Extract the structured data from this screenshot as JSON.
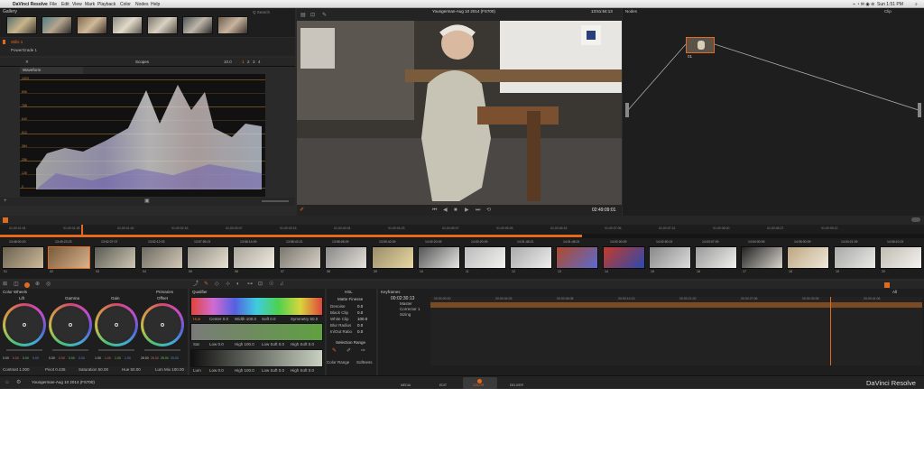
{
  "menubar": {
    "apple": "",
    "app": "DaVinci Resolve",
    "items": [
      "File",
      "Edit",
      "View",
      "Mark",
      "Playback",
      "Color",
      "Nodes",
      "Help"
    ],
    "clock": "Sun 1:51 PM"
  },
  "gallery": {
    "title": "Gallery",
    "search": "Q Search",
    "stills": "Stills 1",
    "powergrade": "PowerGrade 1"
  },
  "scopes": {
    "title": "Scopes",
    "mode": "Waveform",
    "zoom": "10.0",
    "channels": [
      "1",
      "2",
      "3",
      "4"
    ],
    "ticks": [
      "1023",
      "896",
      "768",
      "640",
      "512",
      "384",
      "256",
      "128",
      "0"
    ]
  },
  "viewer": {
    "title": "Youngerman-Aug 10 2014 (FS700)",
    "timecode": "13:51:64:13",
    "current": "02:49:09:01"
  },
  "nodes": {
    "title": "Nodes",
    "clip": "Clip",
    "node_label": "01"
  },
  "ruler": [
    "01:00:01:04",
    "01:00:01:28",
    "01:00:01:40",
    "01:00:02:16",
    "01:00:03:07",
    "01:00:03:15",
    "01:00:04:04",
    "01:00:04:23",
    "01:00:05:07",
    "01:00:05:25",
    "01:00:06:15",
    "01:00:07:06",
    "01:00:07:21",
    "01:00:08:00",
    "01:00:08:27",
    "01:00:09:12"
  ],
  "clip_tcs": [
    "13:48:00:19",
    "13:49:23:23",
    "13:52:07:07",
    "13:52:12:03",
    "13:57:55:21",
    "13:58:14:09",
    "13:58:43:21",
    "13:58:08:09",
    "13:59:42:09",
    "14:00:20:09",
    "14:00:20:09",
    "14:01:48:21",
    "14:01:48:21",
    "14:02:00:09",
    "14:02:50:21",
    "14:03:07:09",
    "14:04:00:09",
    "14:05:00:09",
    "14:04:21:09",
    "14:06:10:21"
  ],
  "clip_labels": [
    "01",
    "02",
    "03",
    "04",
    "05",
    "06",
    "07",
    "08",
    "09",
    "10",
    "11",
    "12",
    "13",
    "14",
    "15",
    "16",
    "17",
    "18",
    "19",
    "20"
  ],
  "color_wheels": {
    "title": "Color Wheels",
    "mode": "Primaries",
    "wheels": [
      {
        "name": "Lift",
        "vals": [
          "0.00",
          "0.00",
          "0.00",
          "0.00"
        ]
      },
      {
        "name": "Gamma",
        "vals": [
          "0.00",
          "0.00",
          "0.00",
          "0.00"
        ]
      },
      {
        "name": "Gain",
        "vals": [
          "1.00",
          "1.00",
          "1.00",
          "1.00"
        ]
      },
      {
        "name": "Offset",
        "vals": [
          "25.00",
          "25.00",
          "25.00",
          "25.00"
        ]
      }
    ],
    "footer": [
      "Contrast 1.000",
      "Pivot 0.435",
      "Saturation 50.00",
      "Hue 50.00",
      "Lum Mix 100.00"
    ]
  },
  "qualifier": {
    "title": "Qualifier",
    "hue": [
      "Hue",
      "Center 0.0",
      "Width 100.0",
      "Soft 0.0",
      "Symmetry 50.0"
    ],
    "sat": [
      "Sat",
      "Low 0.0",
      "High 100.0",
      "Low Soft 0.0",
      "High Soft 0.0"
    ],
    "lum": [
      "Lum",
      "Low 0.0",
      "High 100.0",
      "Low Soft 0.0",
      "High Soft 0.0"
    ]
  },
  "hsl": {
    "title": "HSL",
    "matte": "Matte Finesse",
    "rows": [
      [
        "Denoise",
        "0.0"
      ],
      [
        "Black Clip",
        "0.0"
      ],
      [
        "White Clip",
        "100.0"
      ],
      [
        "Blur Radius",
        "0.0"
      ],
      [
        "In/Out Ratio",
        "0.0"
      ]
    ],
    "selection": "Selection Range",
    "color_range": "Color Range",
    "softness": "Softness"
  },
  "keyframes": {
    "title": "Keyframes",
    "tc": "00:02:30:13",
    "tracks": [
      "Master",
      "Corrector 1",
      "Sizing"
    ],
    "ruler": [
      "00:00:00:00",
      "00:00:04:03",
      "00:00:08:08",
      "00:00:14:13",
      "00:00:21:00",
      "00:00:27:06",
      "00:00:33:05",
      "00:00:41:06"
    ],
    "all": "All"
  },
  "status": {
    "clip": "Youngerman-Aug 10 2014 (FS700)",
    "tabs": [
      "MEDIA",
      "EDIT",
      "COLOR",
      "DELIVER"
    ],
    "brand": "DaVinci Resolve"
  },
  "colors": {
    "accent": "#e26a1e",
    "panel": "#1e1e1e",
    "bg": "#2a2a2a"
  }
}
